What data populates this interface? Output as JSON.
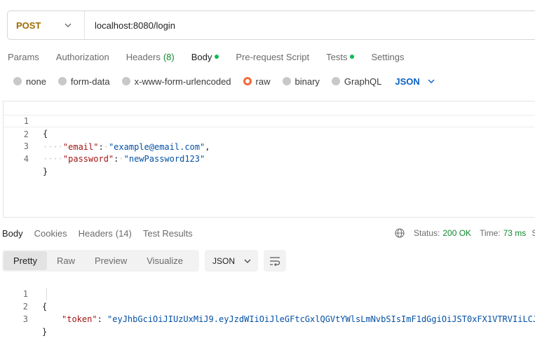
{
  "request": {
    "method": "POST",
    "url": "localhost:8080/login"
  },
  "request_tabs": [
    {
      "label": "Params",
      "active": false
    },
    {
      "label": "Authorization",
      "active": false
    },
    {
      "label": "Headers",
      "count": "(8)",
      "active": false
    },
    {
      "label": "Body",
      "active": true,
      "dot": true
    },
    {
      "label": "Pre-request Script",
      "active": false
    },
    {
      "label": "Tests",
      "active": false,
      "dot": true
    },
    {
      "label": "Settings",
      "active": false
    }
  ],
  "body_types": {
    "options": [
      "none",
      "form-data",
      "x-www-form-urlencoded",
      "raw",
      "binary",
      "GraphQL"
    ],
    "selected": "raw",
    "format": "JSON"
  },
  "request_body": {
    "line_numbers": [
      "1",
      "2",
      "3",
      "4"
    ],
    "open_brace": "{",
    "email_key": "\"email\"",
    "email_value": "\"example@email.com\"",
    "password_key": "\"password\"",
    "password_value": "\"newPassword123\"",
    "close_brace": "}"
  },
  "response_tabs": [
    {
      "label": "Body",
      "active": true
    },
    {
      "label": "Cookies",
      "active": false
    },
    {
      "label": "Headers",
      "count": "(14)",
      "active": false
    },
    {
      "label": "Test Results",
      "active": false
    }
  ],
  "response_status": {
    "status_label": "Status:",
    "status_value": "200 OK",
    "time_label": "Time:",
    "time_value": "73 ms",
    "size_label": "S"
  },
  "response_views": [
    "Pretty",
    "Raw",
    "Preview",
    "Visualize"
  ],
  "response_active_view": "Pretty",
  "response_format": "JSON",
  "response_body": {
    "line_numbers": [
      "1",
      "2",
      "3"
    ],
    "open_brace": "{",
    "token_key": "\"token\"",
    "token_value": "\"eyJhbGciOiJIUzUxMiJ9.eyJzdWIiOiJleGFtcGxlQGVtYWlsLmNvbSIsImF1dGgiOiJST0xFX1VTRVIiLCJ",
    "close_brace": "}"
  },
  "icons": {
    "method_dropdown": "chevron-down-icon",
    "format_dropdown": "chevron-down-icon",
    "network": "globe-icon",
    "wrap": "wrap-lines-icon"
  },
  "colors": {
    "method": "#a36b00",
    "accent_blue": "#0a62c4",
    "success": "#0f8a2e",
    "radio_selected": "#f26b3a",
    "tab_dot": "#0cbb52"
  }
}
